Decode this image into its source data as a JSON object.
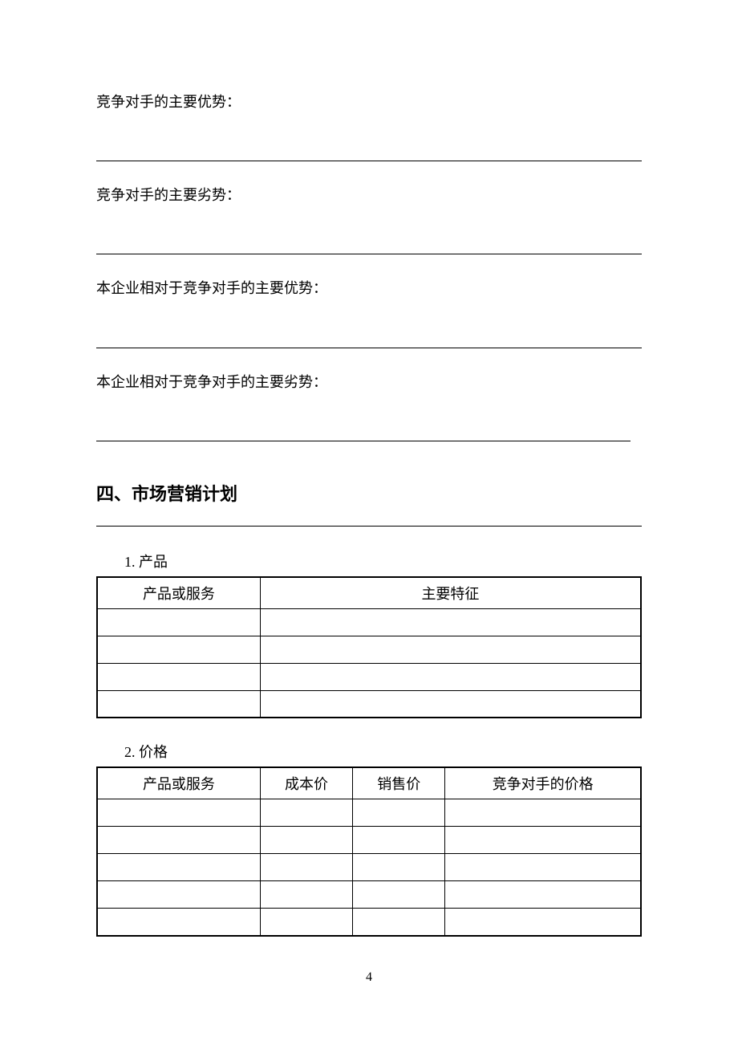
{
  "prompts": {
    "competitor_advantage": "竞争对手的主要优势：",
    "competitor_disadvantage": "竞争对手的主要劣势：",
    "our_advantage": "本企业相对于竞争对手的主要优势：",
    "our_disadvantage": "本企业相对于竞争对手的主要劣势："
  },
  "section4": {
    "heading": "四、市场营销计划",
    "item1": {
      "label": "1. 产品",
      "headers": [
        "产品或服务",
        "主要特征"
      ]
    },
    "item2": {
      "label": "2. 价格",
      "headers": [
        "产品或服务",
        "成本价",
        "销售价",
        "竞争对手的价格"
      ]
    }
  },
  "page_number": "4"
}
